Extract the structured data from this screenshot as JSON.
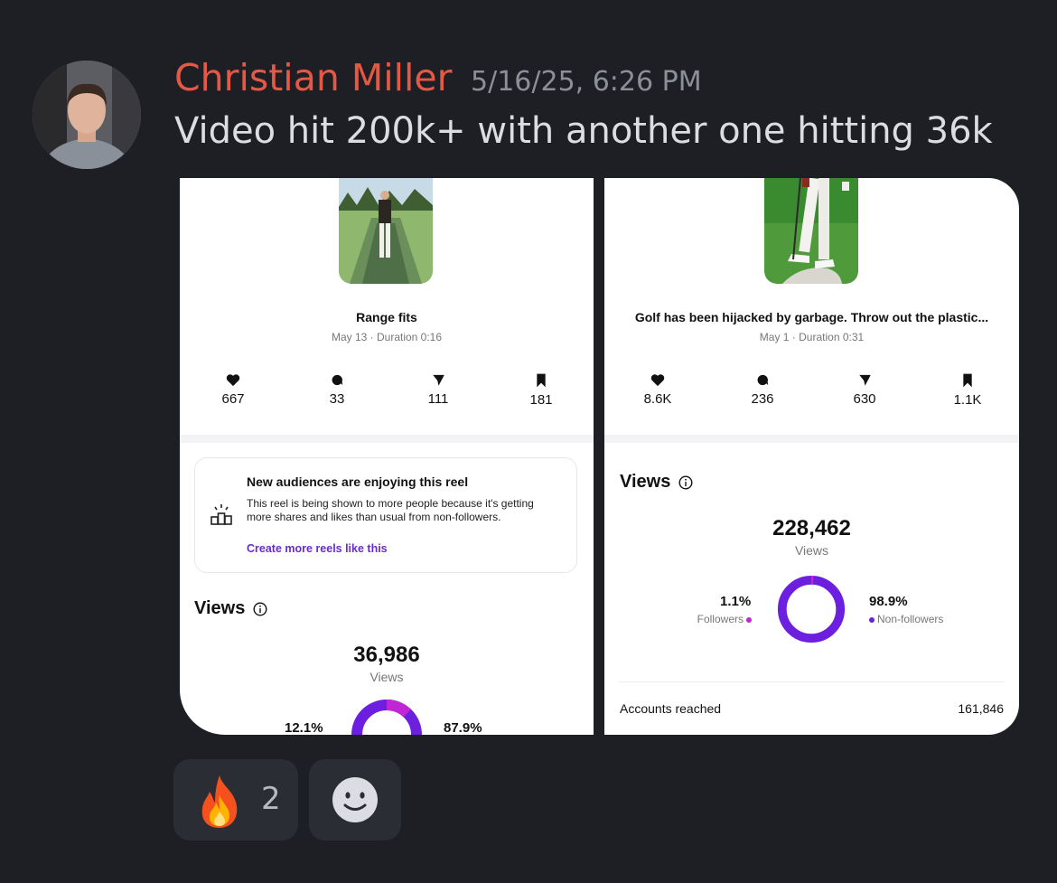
{
  "message": {
    "author": "Christian Miller",
    "timestamp": "5/16/25, 6:26 PM",
    "text": "Video hit 200k+ with another one hitting  36k",
    "author_color": "#e45945"
  },
  "screenshots": [
    {
      "reel_title": "Range fits",
      "reel_meta": "May 13 · Duration 0:16",
      "stats": {
        "likes": "667",
        "comments": "33",
        "shares": "111",
        "saves": "181"
      },
      "audience_card": {
        "title": "New audiences are enjoying this reel",
        "body": "This reel is being shown to more people because it's getting more shares and likes than usual from non-followers.",
        "link": "Create more reels like this"
      },
      "views_heading": "Views",
      "views_total": "36,986",
      "views_label": "Views",
      "followers_pct": "12.1%",
      "nonfollowers_pct": "87.9%",
      "followers_fraction": 0.121
    },
    {
      "reel_title": "Golf has been hijacked by garbage. Throw out the plastic...",
      "reel_meta": "May 1 · Duration 0:31",
      "stats": {
        "likes": "8.6K",
        "comments": "236",
        "shares": "630",
        "saves": "1.1K"
      },
      "views_heading": "Views",
      "views_total": "228,462",
      "views_label": "Views",
      "followers_pct": "1.1%",
      "followers_label": "Followers",
      "nonfollowers_pct": "98.9%",
      "nonfollowers_label": "Non-followers",
      "followers_fraction": 0.011,
      "accounts_reached_label": "Accounts reached",
      "accounts_reached": "161,846"
    }
  ],
  "reactions": [
    {
      "emoji": "fire-emoji",
      "count": "2"
    },
    {
      "emoji": "add-reaction-icon"
    }
  ],
  "colors": {
    "background": "#1e1f24",
    "followers": "#c026d3",
    "nonfollowers": "#6d1fe0",
    "link": "#6a2cc9"
  }
}
